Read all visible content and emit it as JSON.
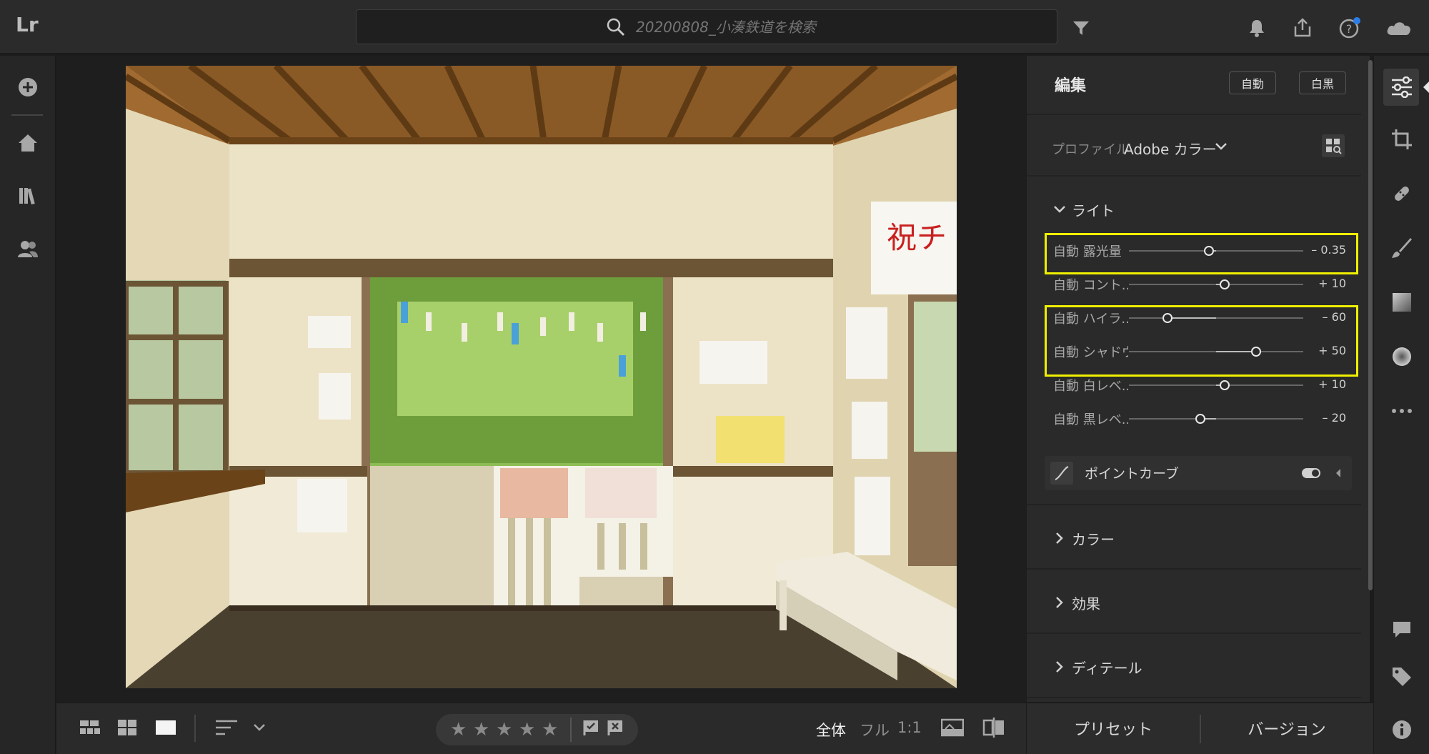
{
  "app": {
    "logo": "Lr"
  },
  "search": {
    "placeholder": "20200808_小湊鉄道を検索"
  },
  "topbar_icons": [
    "filter-icon",
    "bell-icon",
    "share-icon",
    "help-icon",
    "cloud-icon"
  ],
  "left_rail": [
    "add-icon",
    "home-icon",
    "library-icon",
    "people-icon"
  ],
  "edit": {
    "title": "編集",
    "auto_button": "自動",
    "bw_button": "白黒",
    "profile_label": "プロファイル",
    "profile_value": "Adobe カラー",
    "light_section": "ライト",
    "sliders": [
      {
        "name": "自動 露光量",
        "value": "– 0.35",
        "pos": 0.46
      },
      {
        "name": "自動 コント...",
        "value": "+ 10",
        "pos": 0.55
      },
      {
        "name": "自動 ハイラ...",
        "value": "– 60",
        "pos": 0.22
      },
      {
        "name": "自動 シャドウ",
        "value": "+ 50",
        "pos": 0.73
      },
      {
        "name": "自動 白レベ...",
        "value": "+ 10",
        "pos": 0.55
      },
      {
        "name": "自動 黒レベ...",
        "value": "– 20",
        "pos": 0.41
      }
    ],
    "point_curve": "ポイントカーブ",
    "color_section": "カラー",
    "effects_section": "効果",
    "detail_section": "ディテール"
  },
  "bottom": {
    "zoom_all": "全体",
    "zoom_full": "フル",
    "zoom_1to1": "1:1",
    "preset_button": "プリセット",
    "version_button": "バージョン",
    "rating_stars": 5
  },
  "colors": {
    "highlight": "#f0f000",
    "background": "#2a2a2a",
    "badge": "#2d7de8"
  }
}
